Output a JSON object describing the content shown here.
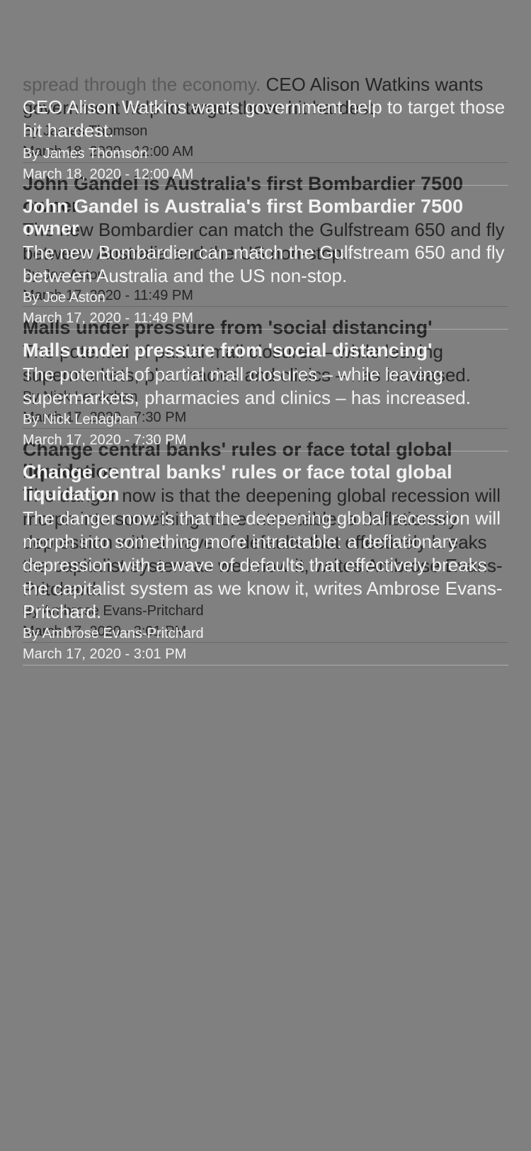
{
  "first_article": {
    "summary_faded": "spread through the economy.",
    "summary_main": " CEO Alison Watkins wants government help to target those hit hardest.",
    "byline": "By James Thomson",
    "date": "March 18, 2020 - 12:00 AM"
  },
  "articles": [
    {
      "headline": "John Gandel is Australia's first Bombardier 7500 owner",
      "summary": "The new Bombardier can match the Gulfstream 650 and fly between Australia and the US non-stop.",
      "byline": "By Joe Aston",
      "date": "March 17, 2020 - 11:49 PM"
    },
    {
      "headline": "Malls under pressure from 'social distancing'",
      "summary": "The potential of partial mall closures – while leaving supermarkets, pharmacies and clinics – has increased.",
      "byline": "By Nick Lenaghan",
      "date": "March 17, 2020 - 7:30 PM"
    },
    {
      "headline": "Change central banks' rules or face total global liquidation",
      "summary": "The danger now is that the deepening global recession will morph into something more intractable: a deflationary depression with a wave of defaults that effectively breaks the capitalist system as we know it, writes Ambrose Evans-Pritchard.",
      "byline": "By Ambrose Evans-Pritchard",
      "date": "March 17, 2020 - 3:01 PM"
    }
  ]
}
